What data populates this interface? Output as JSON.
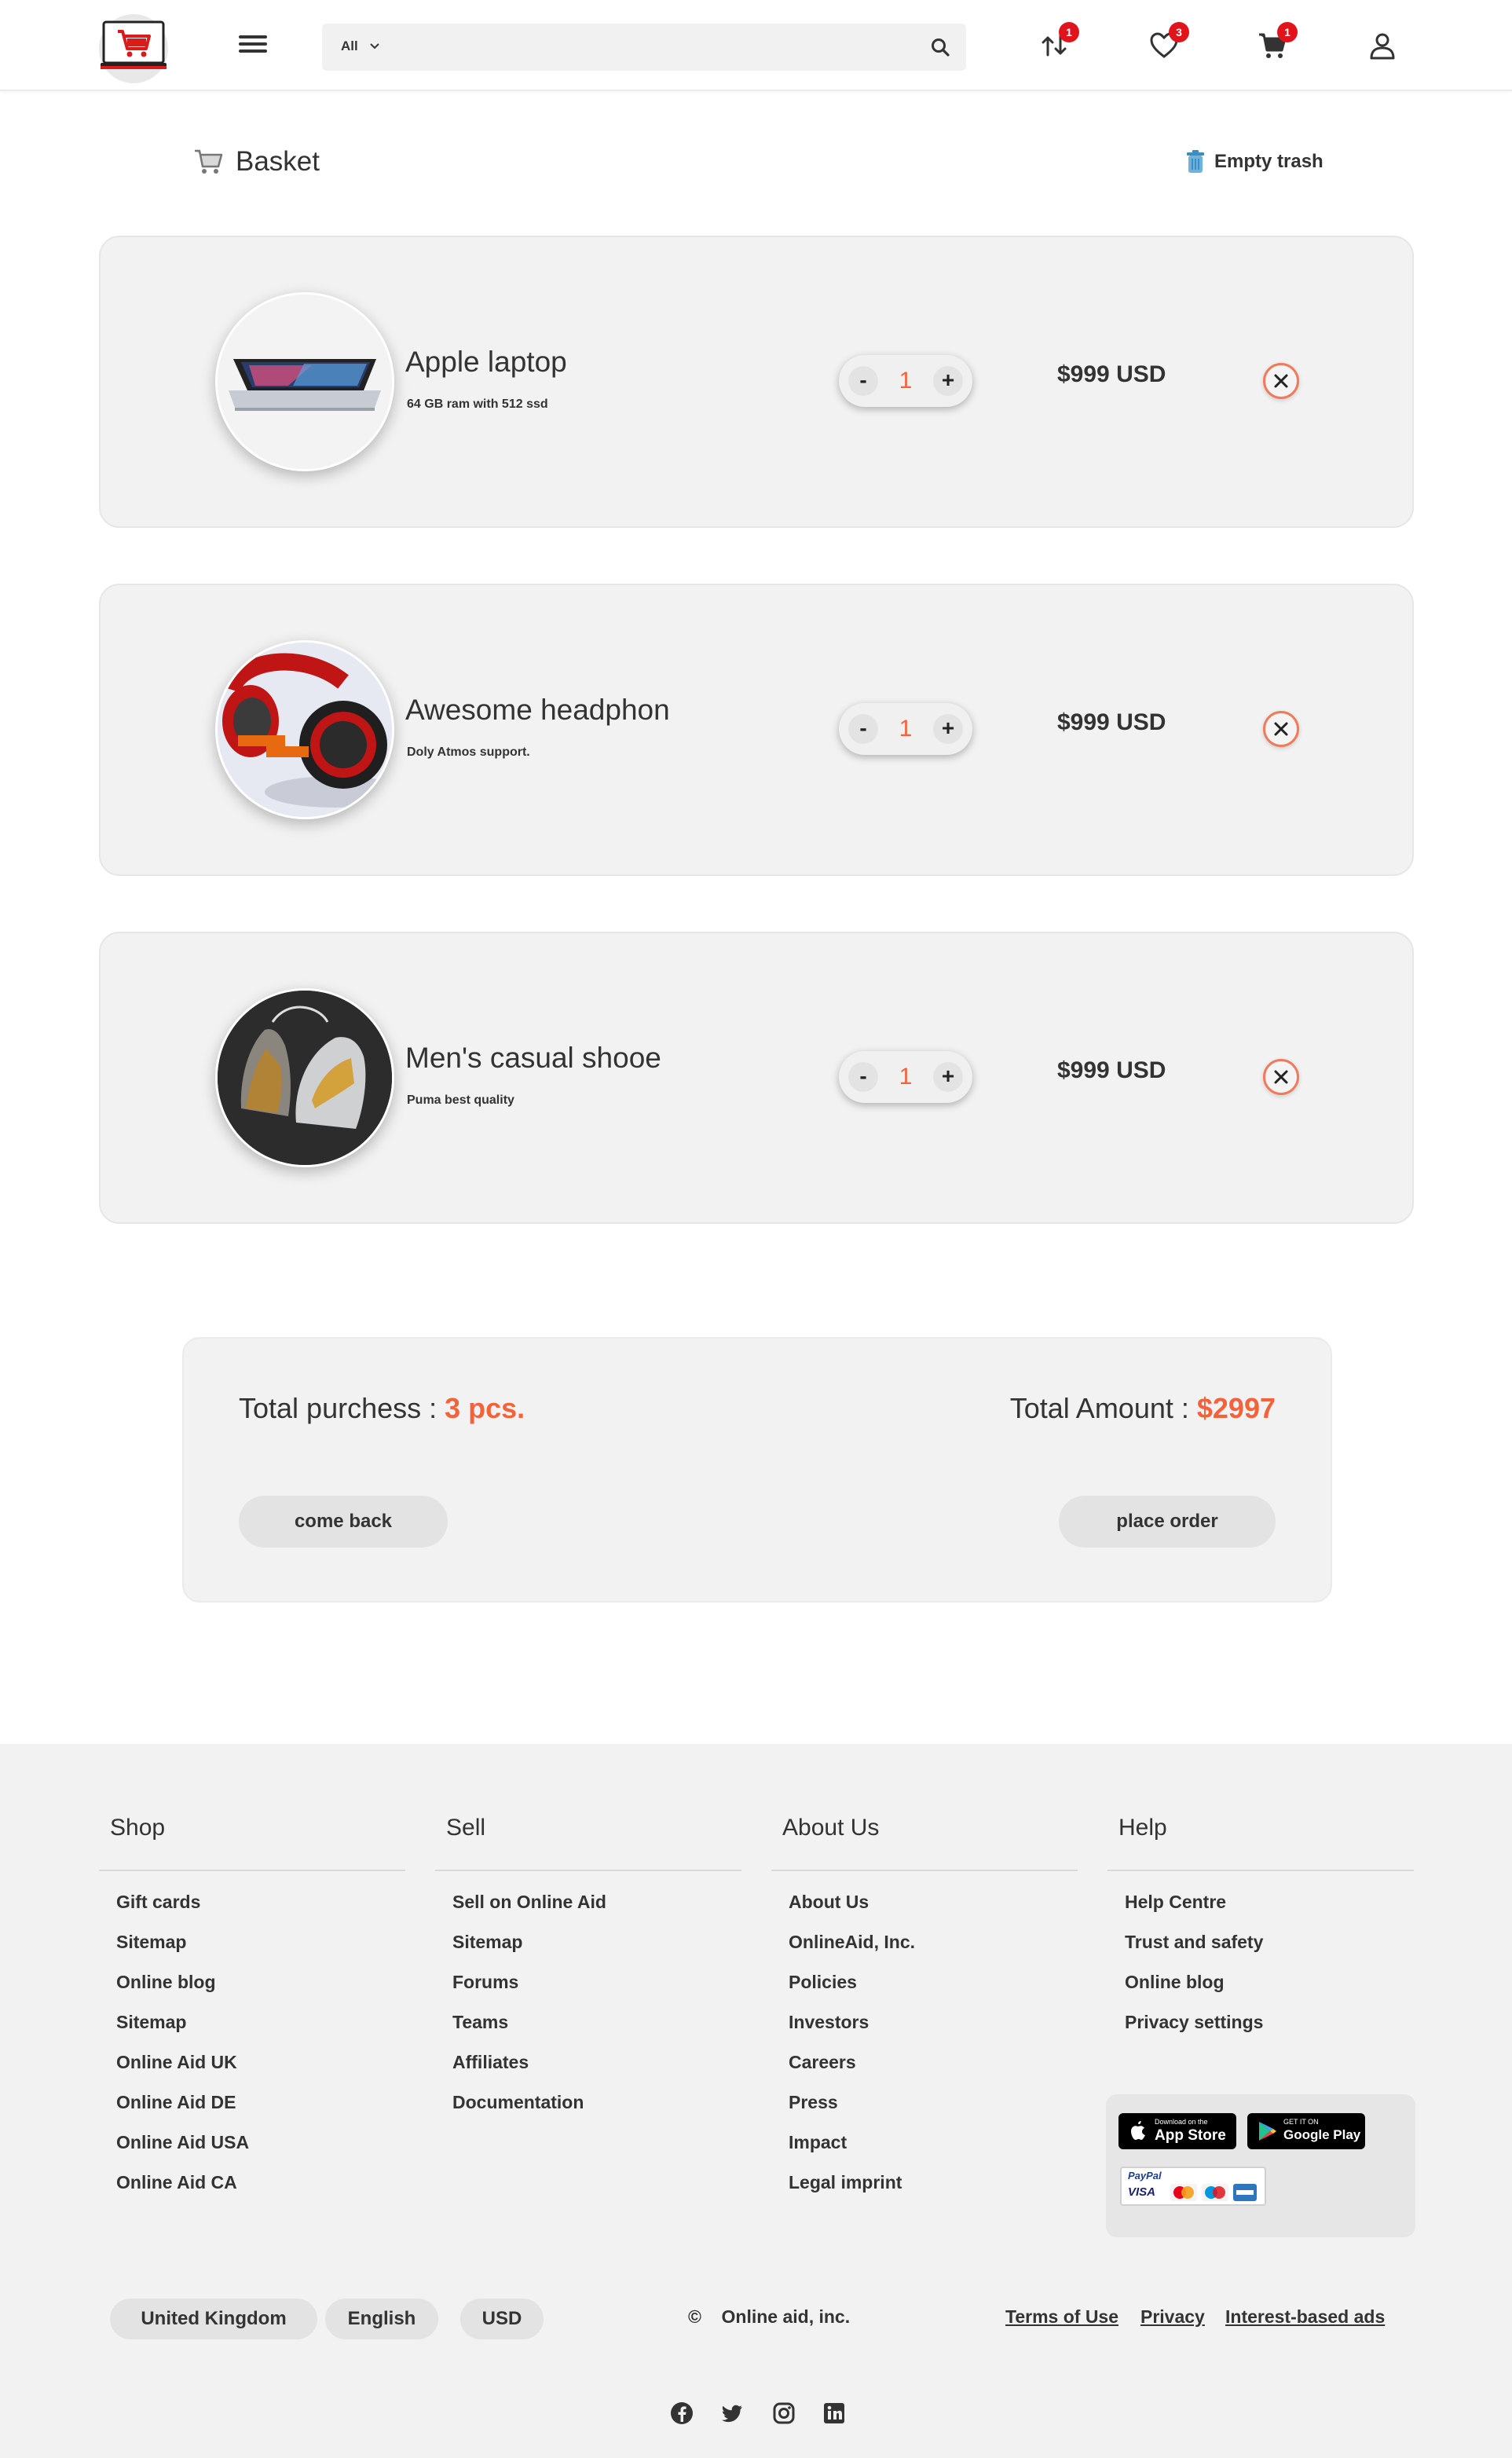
{
  "colors": {
    "accent": "#f4623a",
    "badge": "#e1141c",
    "card": "#f2f2f2",
    "text": "#333333"
  },
  "header": {
    "search": {
      "category": "All",
      "placeholder": ""
    },
    "icons": [
      {
        "name": "compare-icon",
        "badge": "1"
      },
      {
        "name": "heart-icon",
        "badge": "3"
      },
      {
        "name": "cart-icon",
        "badge": "1"
      },
      {
        "name": "user-icon",
        "badge": ""
      }
    ]
  },
  "basket": {
    "title": "Basket",
    "empty_label": "Empty trash",
    "items": [
      {
        "name": "Apple laptop",
        "desc": "64 GB ram with 512 ssd",
        "qty": "1",
        "price": "$999 USD",
        "image": "laptop"
      },
      {
        "name": "Awesome headphon",
        "desc": "Doly Atmos support.",
        "qty": "1",
        "price": "$999 USD",
        "image": "headphone"
      },
      {
        "name": "Men's casual shooe",
        "desc": "Puma best quality",
        "qty": "1",
        "price": "$999 USD",
        "image": "shoes"
      }
    ],
    "minus": "-",
    "plus": "+"
  },
  "summary": {
    "purchase_label": "Total purchess : ",
    "purchase_value": "3 pcs.",
    "amount_label": "Total Amount : ",
    "amount_value": "$2997",
    "back_label": "come back",
    "order_label": "place order"
  },
  "footer": {
    "columns": [
      {
        "title": "Shop",
        "links": [
          "Gift cards",
          "Sitemap",
          "Online blog",
          "Sitemap",
          "Online Aid UK",
          "Online Aid DE",
          "Online Aid USA",
          "Online Aid CA"
        ]
      },
      {
        "title": "Sell",
        "links": [
          "Sell on Online Aid",
          "Sitemap",
          "Forums",
          "Teams",
          "Affiliates",
          "Documentation"
        ]
      },
      {
        "title": "About Us",
        "links": [
          "About Us",
          "OnlineAid, Inc.",
          "Policies",
          "Investors",
          "Careers",
          "Press",
          "Impact",
          "Legal imprint"
        ]
      },
      {
        "title": "Help",
        "links": [
          "Help Centre",
          "Trust and safety",
          "Online blog",
          "Privacy settings"
        ]
      }
    ],
    "apps": {
      "appstore_small": "Download on the",
      "appstore_big": "App Store",
      "googleplay_small": "GET IT ON",
      "googleplay_big": "Google Play",
      "paypal": "PayPal",
      "visa": "VISA"
    },
    "region": "United Kingdom",
    "language": "English",
    "currency": "USD",
    "copyright_symbol": "©",
    "copyright": "Online aid, inc.",
    "links": [
      "Terms of Use",
      "Privacy",
      "Interest-based ads"
    ],
    "social": [
      "facebook-icon",
      "twitter-icon",
      "instagram-icon",
      "linkedin-icon"
    ]
  }
}
